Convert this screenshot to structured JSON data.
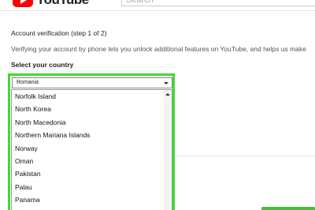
{
  "brand": {
    "logo_text": "YouTube"
  },
  "search": {
    "placeholder": "Search"
  },
  "verification": {
    "title": "Account verification (step 1 of 2)",
    "description": "Verifying your account by phone lets you unlock additional features on YouTube, and helps us make",
    "select_label": "Select your country"
  },
  "country_select": {
    "selected_value": "Romania",
    "options": [
      "Norfolk Island",
      "North Korea",
      "North Macedonia",
      "Northern Mariana Islands",
      "Norway",
      "Oman",
      "Pakistan",
      "Palau",
      "Panama"
    ]
  },
  "colors": {
    "highlight_border": "#3ddc2e",
    "youtube_red": "#ff0000",
    "button_green": "#4bbd3c"
  }
}
